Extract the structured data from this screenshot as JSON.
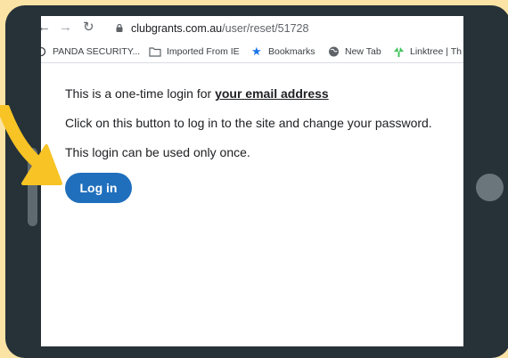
{
  "browser": {
    "url_host": "clubgrants.com.au",
    "url_path": "/user/reset/51728",
    "bookmarks": [
      {
        "label": "PANDA SECURITY...",
        "icon": "panda-icon"
      },
      {
        "label": "Imported From IE",
        "icon": "folder-icon"
      },
      {
        "label": "Bookmarks",
        "icon": "star-icon"
      },
      {
        "label": "New Tab",
        "icon": "globe-icon"
      },
      {
        "label": "Linktree | Th",
        "icon": "linktree-icon"
      }
    ]
  },
  "page": {
    "line1_prefix": "This is a one-time login for ",
    "line1_link": "your email address",
    "line2": "Click on this button to log in to the site and change your password.",
    "line3": "This login can be used only once.",
    "login_button": "Log in"
  },
  "colors": {
    "background": "#fbe3a5",
    "tablet": "#263238",
    "button": "#1f6fbd",
    "arrow": "#f7c325"
  }
}
